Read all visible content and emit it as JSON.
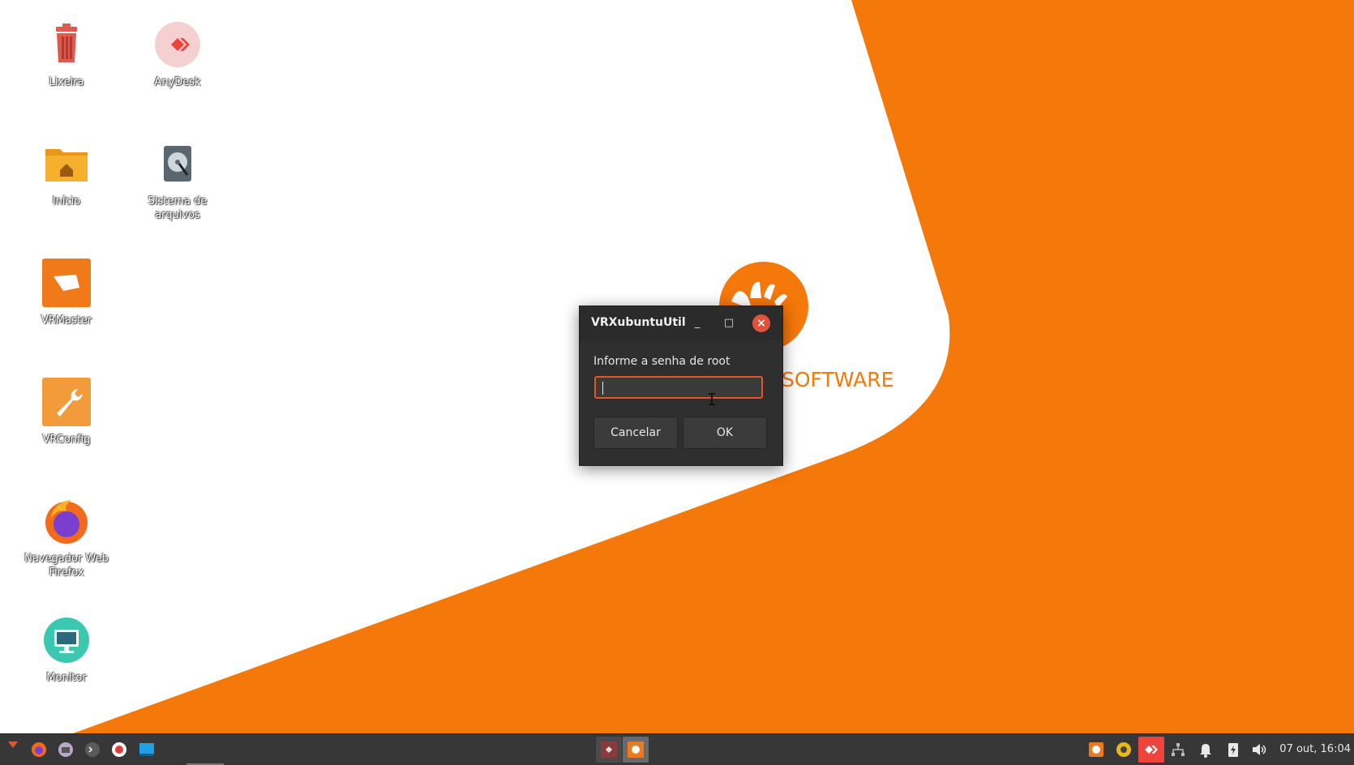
{
  "desktop": {
    "icons": [
      {
        "label": "Lixeira",
        "icon": "trash-icon"
      },
      {
        "label": "AnyDesk",
        "icon": "anydesk-icon"
      },
      {
        "label": "Início",
        "icon": "home-folder-icon"
      },
      {
        "label": "Sistema de arquivos",
        "icon": "filesystem-icon"
      },
      {
        "label": "VRMaster",
        "icon": "vrmaster-icon"
      },
      {
        "label": "VRConfig",
        "icon": "wrench-icon"
      },
      {
        "label": "Navegador Web Firefox",
        "icon": "firefox-icon"
      },
      {
        "label": "Monitor",
        "icon": "monitor-icon"
      }
    ],
    "wallpaper_text": "SOFTWARE"
  },
  "dialog": {
    "title": "VRXubuntuUtil",
    "minimize": "_",
    "maximize": "□",
    "close": "×",
    "prompt": "Informe a senha de root",
    "password_value": "",
    "cancel_label": "Cancelar",
    "ok_label": "OK"
  },
  "taskbar": {
    "clock": "07 out, 16:04"
  },
  "colors": {
    "wallpaper_orange": "#F5780A",
    "dialog_bg": "#2F2F2F",
    "focus_border": "#E2552B",
    "close_button": "#E0533A"
  }
}
